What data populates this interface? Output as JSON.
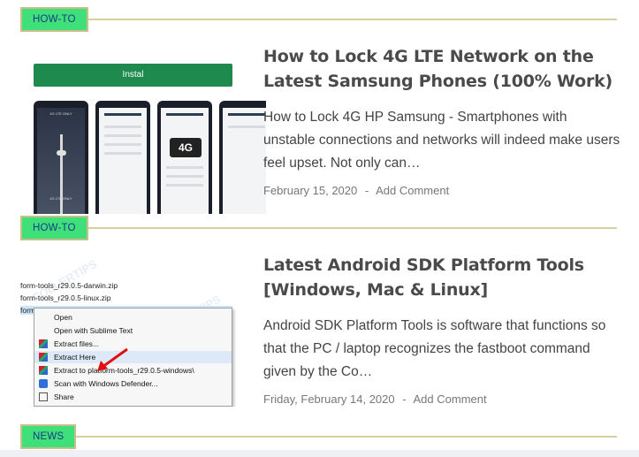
{
  "sections": [
    {
      "tag": "HOW-TO"
    },
    {
      "tag": "HOW-TO"
    },
    {
      "tag": "NEWS"
    }
  ],
  "posts": [
    {
      "title": "How to Lock 4G LTE Network on the Latest Samsung Phones (100% Work)",
      "excerpt": "How to Lock 4G HP Samsung - Smartphones with unstable connections and networks will indeed make users feel upset. Not only can…",
      "date": "February 15, 2020",
      "separator": "-",
      "comment_link": "Add Comment",
      "thumb": {
        "install_label": "Instal",
        "phone_caption_top": "4G LTE ONLY",
        "phone_caption_bottom": "4G LTE ONLY",
        "badge": "4G"
      }
    },
    {
      "title": "Latest Android SDK Platform Tools [Windows, Mac & Linux]",
      "excerpt": "Android SDK Platform Tools is software that functions so that the PC / laptop recognizes the fastboot command given by the Co…",
      "date": "Friday, February 14, 2020",
      "separator": "-",
      "comment_link": "Add Comment",
      "thumb": {
        "files": [
          "form-tools_r29.0.5-darwin.zip",
          "form-tools_r29.0.5-linux.zip",
          "form"
        ],
        "menu": [
          "Open",
          "Open with Sublime Text",
          "Extract files...",
          "Extract Here",
          "Extract to platform-tools_r29.0.5-windows\\",
          "Scan with Windows Defender...",
          "Share"
        ],
        "watermark": "FOLLERTIPS"
      }
    }
  ],
  "colors": {
    "tag_bg": "#3fe07a",
    "tag_text": "#1a3a8a",
    "rule": "#d9cf9a",
    "install_btn": "#1e8a4e"
  }
}
